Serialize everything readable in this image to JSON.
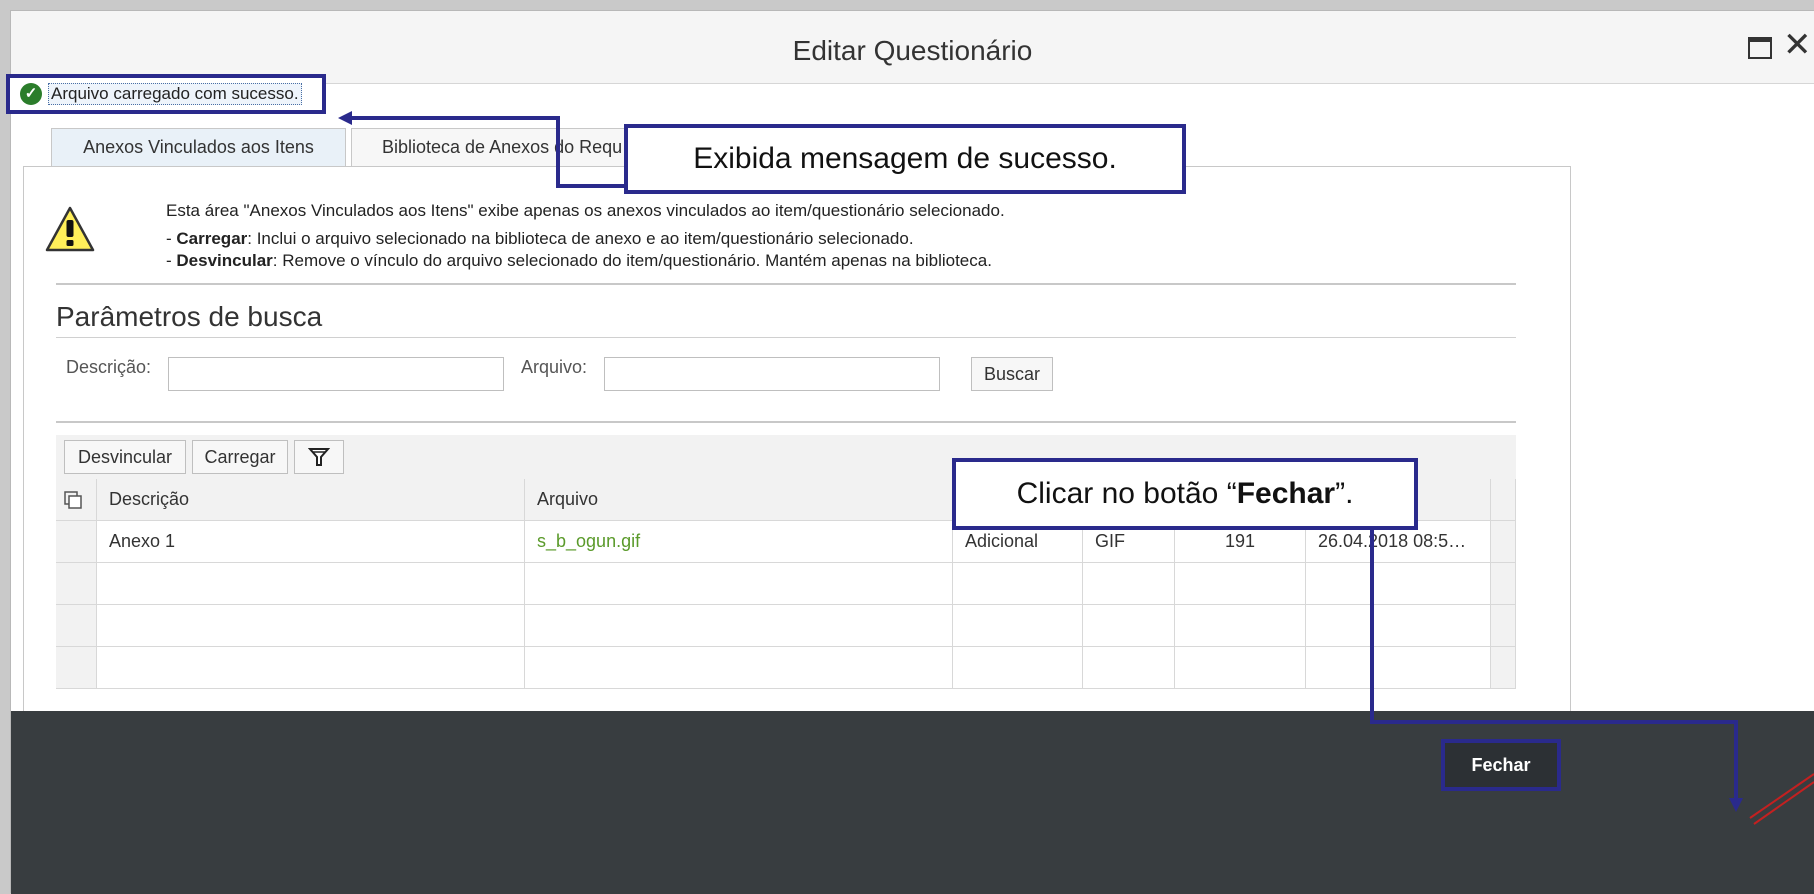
{
  "window": {
    "title": "Editar Questionário",
    "maximize_icon": "maximize-icon",
    "close_glyph": "✕"
  },
  "message": {
    "text": "Arquivo carregado com sucesso.",
    "icon": "checkmark-circle-icon"
  },
  "tabs": [
    {
      "label": "Anexos Vinculados aos Itens"
    },
    {
      "label": "Biblioteca de Anexos do Requ"
    }
  ],
  "info": {
    "line1": "Esta área \"Anexos Vinculados aos Itens\" exibe apenas os anexos vinculados ao item/questionário selecionado.",
    "line2_bold": "Carregar",
    "line2_rest": ": Inclui o arquivo selecionado na biblioteca de anexo e ao item/questionário selecionado.",
    "line3_bold": "Desvincular",
    "line3_rest": ": Remove o vínculo do arquivo selecionado do item/questionário. Mantém apenas na biblioteca.",
    "bullet_prefix": "- "
  },
  "search": {
    "title": "Parâmetros de busca",
    "desc_label": "Descrição:",
    "arq_label": "Arquivo:",
    "desc_value": "",
    "arq_value": "",
    "button": "Buscar"
  },
  "toolbar": {
    "unlink": "Desvincular",
    "upload": "Carregar",
    "filter_icon": "filter-icon"
  },
  "table": {
    "columns": [
      "Descrição",
      "Arquivo",
      "",
      "",
      "",
      ""
    ],
    "rows": [
      [
        "Anexo 1",
        "s_b_ogun.gif",
        "Adicional",
        "GIF",
        "191",
        "26.04.2018 08:5…"
      ],
      [
        "",
        "",
        "",
        "",
        "",
        ""
      ],
      [
        "",
        "",
        "",
        "",
        "",
        ""
      ],
      [
        "",
        "",
        "",
        "",
        "",
        ""
      ]
    ]
  },
  "footer": {
    "close_button": "Fechar"
  },
  "annotations": {
    "success": "Exibida mensagem de sucesso.",
    "fechar_prefix": "Clicar no botão “",
    "fechar_bold": "Fechar",
    "fechar_suffix": "”."
  },
  "colors": {
    "callout_border": "#2a2a8c",
    "footer_bg": "#383d40",
    "success_green": "#2b7d2b",
    "link_green": "#5a9a2a"
  }
}
